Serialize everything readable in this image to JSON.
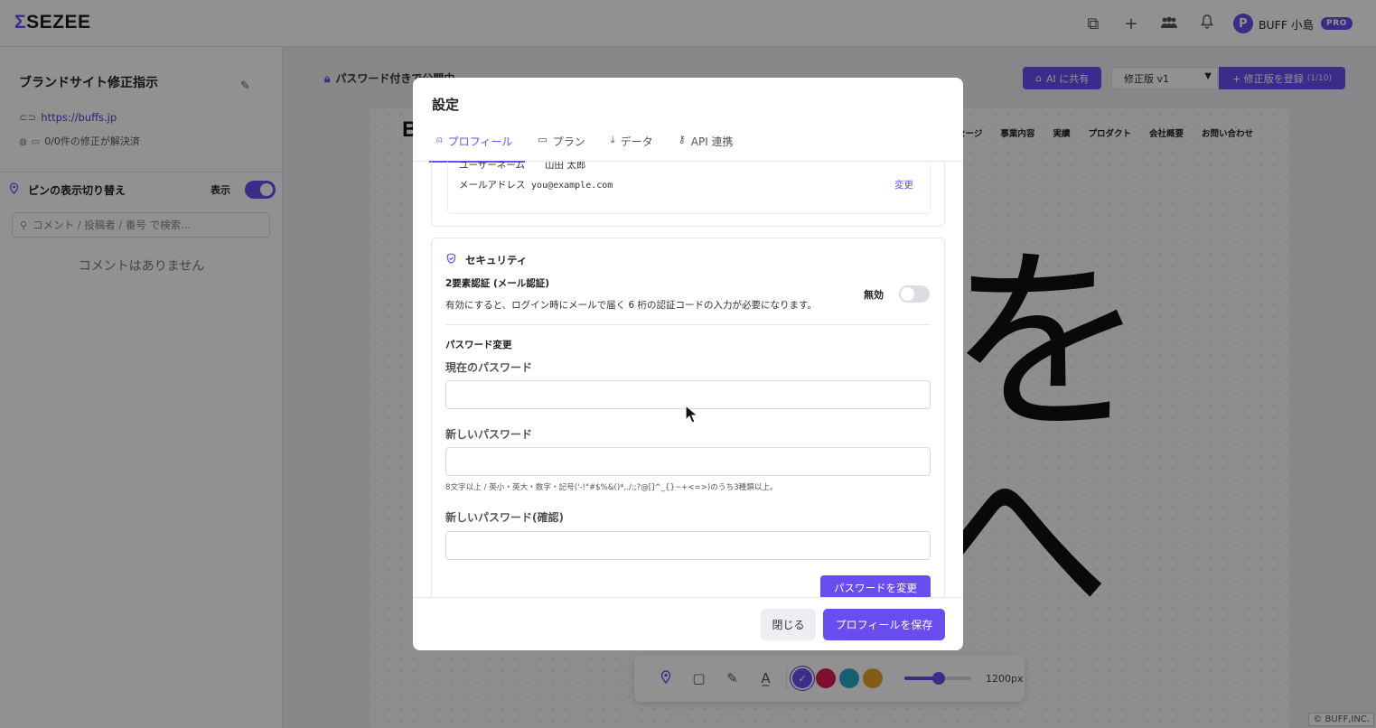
{
  "app": {
    "logo_mark": "Σ",
    "logo_text": "SEZEE"
  },
  "header": {
    "user_initial": "P",
    "user_name": "BUFF 小島",
    "plan_badge": "PRO",
    "icons": [
      "copy-window-icon",
      "plus-icon",
      "team-icon",
      "bell-icon"
    ]
  },
  "sidebar": {
    "project_title": "ブランドサイト修正指示",
    "project_url": "https://buffs.jp",
    "status_text": "0/0件の修正が解決済",
    "pin_toggle_label": "ピンの表示切り替え",
    "pin_toggle_state": "表示",
    "search_placeholder": "コメント / 投稿者 / 番号 で検索...",
    "empty_text": "コメントはありません"
  },
  "main": {
    "visibility_label": "パスワード付きで公開中",
    "ai_share_label": "AI に共有",
    "version_selected": "修正版 v1",
    "register_label": "+ 修正版を登録",
    "register_count": "(1/10)",
    "site_nav": [
      "メッセージ",
      "事業内容",
      "実績",
      "プロダクト",
      "会社概要",
      "お問い合わせ"
    ],
    "site_logo_letter": "B",
    "hand_text_1": "を",
    "hand_text_2": "へ"
  },
  "toolbar": {
    "tools": [
      "pin-tool-icon",
      "rect-tool-icon",
      "pen-tool-icon",
      "text-tool-icon"
    ],
    "colors": [
      "#6a4df0",
      "#d81b4e",
      "#26a7c9",
      "#e9a22a"
    ],
    "selected_color": "#6a4df0",
    "size_value": 0.52,
    "size_label": "1200px"
  },
  "copyright": "© BUFF,INC.",
  "modal": {
    "title": "設定",
    "tabs": [
      {
        "label": "プロフィール",
        "icon": "user-icon",
        "active": true
      },
      {
        "label": "プラン",
        "icon": "card-icon",
        "active": false
      },
      {
        "label": "データ",
        "icon": "download-icon",
        "active": false
      },
      {
        "label": "API 連携",
        "icon": "key-icon",
        "active": false
      }
    ],
    "profile": {
      "username_label": "ユーザーネーム",
      "username_value": "山田 太郎",
      "email_label": "メールアドレス",
      "email_value": "you@example.com",
      "change_link": "変更"
    },
    "security": {
      "heading": "セキュリティ",
      "tfa_title": "2要素認証 (メール認証)",
      "tfa_desc": "有効にすると、ログイン時にメールで届く 6 桁の認証コードの入力が必要になります。",
      "tfa_state": "無効",
      "tfa_enabled": false,
      "pw_change_title": "パスワード変更",
      "current_pw_label": "現在のパスワード",
      "new_pw_label": "新しいパスワード",
      "pw_hint": "8文字以上 / 英小・英大・数字・記号('-!\"#$%&()*,./:;?@[]^_{}~+<=>)のうち3種類以上。",
      "confirm_pw_label": "新しいパスワード(確認)",
      "change_button": "パスワードを変更"
    },
    "footer": {
      "close_label": "閉じる",
      "save_label": "プロフィールを保存"
    }
  }
}
